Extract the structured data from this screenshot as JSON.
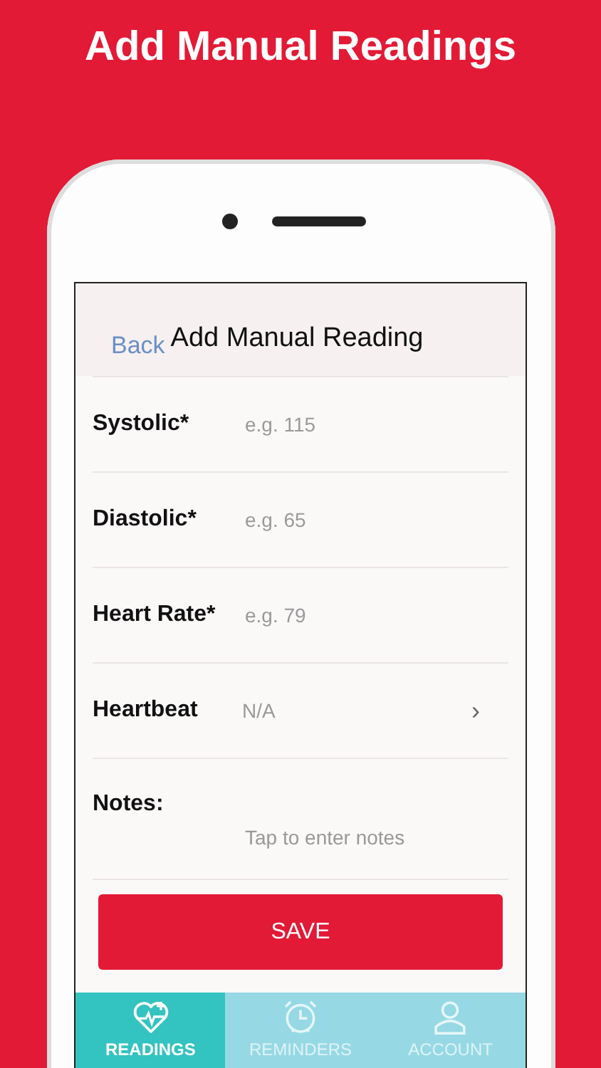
{
  "headline": "Add Manual Readings",
  "header": {
    "back": "Back",
    "title": "Add Manual Reading"
  },
  "fields": [
    {
      "kind": "input",
      "label": "Systolic*",
      "placeholder": "e.g. 115"
    },
    {
      "kind": "input",
      "label": "Diastolic*",
      "placeholder": "e.g. 65"
    },
    {
      "kind": "input",
      "label": "Heart Rate*",
      "placeholder": "e.g. 79"
    },
    {
      "kind": "select",
      "label": "Heartbeat",
      "value": "N/A",
      "chevron": "›"
    },
    {
      "kind": "notes",
      "label": "Notes:",
      "placeholder": "Tap to enter notes"
    }
  ],
  "save": "SAVE",
  "tabs": [
    {
      "kind": "heart",
      "label": "READINGS",
      "selected": true
    },
    {
      "kind": "clock",
      "label": "REMINDERS",
      "selected": false
    },
    {
      "kind": "person",
      "label": "ACCOUNT",
      "selected": false
    }
  ]
}
